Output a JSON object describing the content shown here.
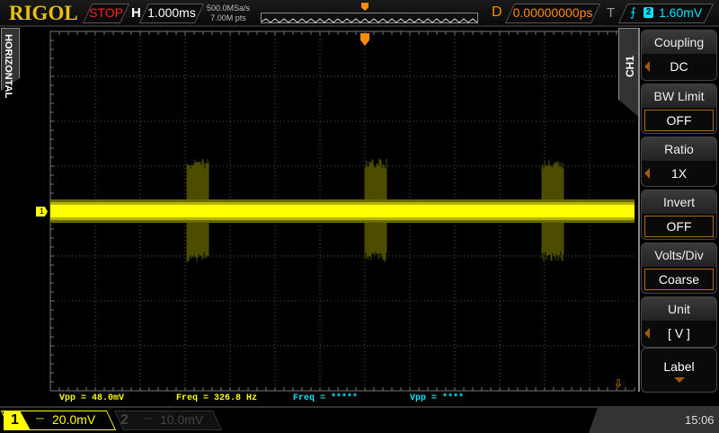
{
  "header": {
    "logo": "RIGOL",
    "run_state": "STOP",
    "timebase_label": "H",
    "timebase": "1.000ms",
    "sample_rate": "500.0MSa/s",
    "memory_depth": "7.00M pts",
    "delay_label": "D",
    "delay": "0.00000000ps",
    "trigger_label": "T",
    "trigger_source": "2",
    "trigger_level": "1.60mV"
  },
  "side_tabs": {
    "horizontal": "HORIZONTAL",
    "channel": "CH1"
  },
  "channel_marker": "1",
  "measurements": [
    {
      "text": "Vpp = 48.0mV",
      "color": "#ffff00"
    },
    {
      "text": "Freq = 326.8 Hz",
      "color": "#ffff00"
    },
    {
      "text": "Freq = *****",
      "color": "#00e5ff"
    },
    {
      "text": "Vpp = ****",
      "color": "#00e5ff"
    }
  ],
  "channels": [
    {
      "num": "1",
      "coupling": "⎓",
      "scale": "20.0mV",
      "active": true
    },
    {
      "num": "2",
      "coupling": "⎓",
      "scale": "10.0mV",
      "active": false
    }
  ],
  "clock": "15:06",
  "menu": [
    {
      "title": "Coupling",
      "value": "DC",
      "type": "arrow"
    },
    {
      "title": "BW Limit",
      "value": "OFF",
      "type": "boxed"
    },
    {
      "title": "Ratio",
      "value": "1X",
      "type": "arrow"
    },
    {
      "title": "Invert",
      "value": "OFF",
      "type": "boxed"
    },
    {
      "title": "Volts/Div",
      "value": "Coarse",
      "type": "boxed"
    },
    {
      "title": "Unit",
      "value": "[  V  ]",
      "type": "arrow"
    },
    {
      "title": "Label",
      "value": "",
      "type": "more"
    }
  ],
  "colors": {
    "ch1": "#ffff00",
    "ch2": "#00e5ff",
    "accent": "#ff8c00"
  }
}
